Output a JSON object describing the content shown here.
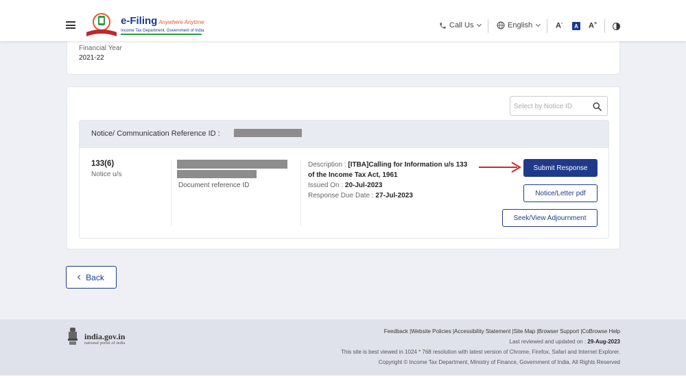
{
  "header": {
    "logo_title": "e-Filing",
    "logo_tagline": "Anywhere Anytime",
    "logo_subtitle": "Income Tax Department, Government of India",
    "call_us": "Call Us",
    "language": "English",
    "font_decrease": "A",
    "font_normal": "A",
    "font_increase": "A",
    "font_decrease_sup": "-",
    "font_increase_sup": "+"
  },
  "financial_year": {
    "label": "Financial Year",
    "value": "2021-22"
  },
  "search": {
    "placeholder": "Select by Notice ID"
  },
  "notice": {
    "ref_label": "Notice/ Communication Reference ID :",
    "section": "133(6)",
    "section_label": "Notice u/s",
    "doc_ref_label": "Document reference ID",
    "description_label": "Description :",
    "description_value": "[ITBA]Calling for Information u/s 133 of the Income Tax Act, 1961",
    "issued_label": "Issued On :",
    "issued_value": "20-Jul-2023",
    "due_label": "Response Due Date :",
    "due_value": "27-Jul-2023"
  },
  "buttons": {
    "submit_response": "Submit Response",
    "notice_pdf": "Notice/Letter pdf",
    "adjournment": "Seek/View Adjournment",
    "back": "Back"
  },
  "footer": {
    "portal_name": "india.gov.in",
    "portal_sub": "national portal of india",
    "links": [
      "Feedback",
      "Website Policies",
      "Accessibility Statement",
      "Site Map",
      "Browser Support",
      "CoBrowse Help"
    ],
    "last_reviewed_label": "Last reviewed and updated on :",
    "last_reviewed_date": "29-Aug-2023",
    "best_viewed": "This site is best viewed in 1024 * 768 resolution with latest version of Chrome, Firefox, Safari and Internet Explorer.",
    "copyright": "Copyright © Income Tax Department, Ministry of Finance, Government of India. All Rights Reserved"
  },
  "icons": {
    "menu": "hamburger-icon",
    "phone": "phone-icon",
    "globe": "globe-icon",
    "contrast": "contrast-icon",
    "search": "search-icon",
    "back": "chevron-left-icon",
    "emblem": "national-emblem-icon"
  },
  "colors": {
    "brand": "#1f3a8a",
    "annotation_arrow": "#e02020",
    "footer_bg": "#dfe2ea"
  }
}
